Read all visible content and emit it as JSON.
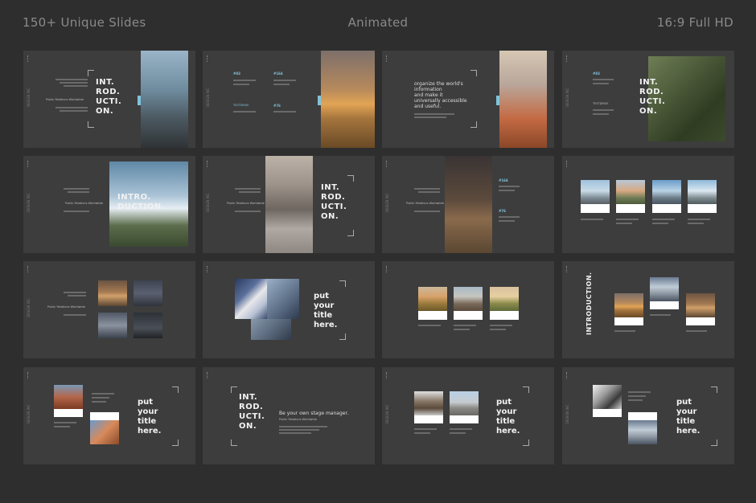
{
  "header": {
    "left": "150+ Unique Slides",
    "center": "Animated",
    "right": "16:9 Full HD"
  },
  "slides": {
    "intro_split": "INT.\nROD.\nUCTI.\nON.",
    "intro_word": "INTRO.\nDUCTION.",
    "intro_vertical": "INTRODUCTION.",
    "put_title": "put\nyour\ntitle\nhere.",
    "organize_text": "organize the world's\ninformation\nand make it\nuniversally accessible\nand useful.",
    "stage_manager": "Be your own stage manager.",
    "public_relations": "Public Relations Worldwide",
    "side_label": "DESIGN INC",
    "numbers": [
      "#83",
      "#164",
      "#76",
      "#164",
      "#76",
      "#83"
    ],
    "testdrive": "TESTDRIVE"
  },
  "colors": {
    "background": "#2e2e2e",
    "slide": "#3d3d3d",
    "accent": "#7fc3d9"
  }
}
